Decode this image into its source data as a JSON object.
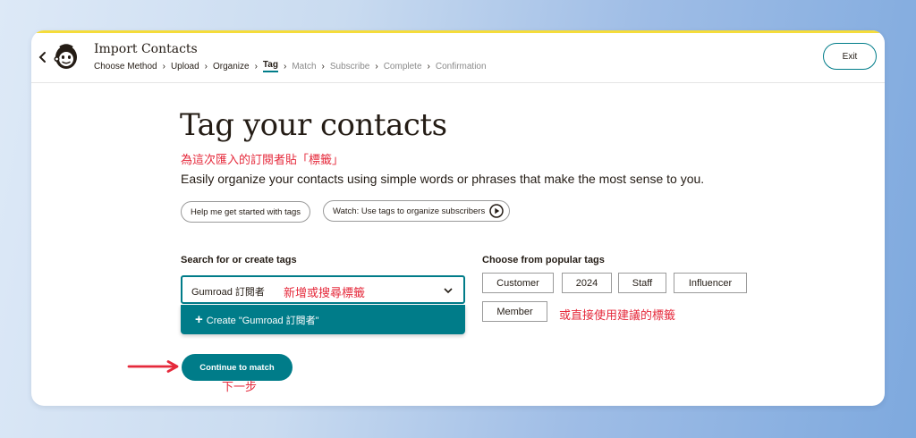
{
  "header": {
    "app_title": "Import Contacts",
    "exit_label": "Exit",
    "breadcrumbs": [
      {
        "label": "Choose Method"
      },
      {
        "label": "Upload"
      },
      {
        "label": "Organize"
      },
      {
        "label": "Tag"
      },
      {
        "label": "Match"
      },
      {
        "label": "Subscribe"
      },
      {
        "label": "Complete"
      },
      {
        "label": "Confirmation"
      }
    ],
    "separator": "›"
  },
  "main": {
    "title": "Tag your contacts",
    "subtitle": "Easily organize your contacts using simple words or phrases that make the most sense to you.",
    "help_button": "Help me get started with tags",
    "video_button": "Watch: Use tags to organize subscribers",
    "search_label": "Search for or create tags",
    "search_value": "Gumroad 訂閱者",
    "create_option": "Create \"Gumroad 訂閱者\"",
    "create_plus": "+",
    "popular_label": "Choose from popular tags",
    "popular_tags": [
      "Customer",
      "2024",
      "Staff",
      "Influencer",
      "Member"
    ],
    "continue_button": "Continue to match"
  },
  "annotations": {
    "title_note": "為這次匯入的訂閱者貼「標籤」",
    "search_note": "新增或搜尋標籤",
    "popular_note": "或直接使用建議的標籤",
    "continue_note": "下一步"
  },
  "colors": {
    "accent": "#007c89",
    "annotation": "#e5293b",
    "top_stripe": "#f5dc3a"
  }
}
